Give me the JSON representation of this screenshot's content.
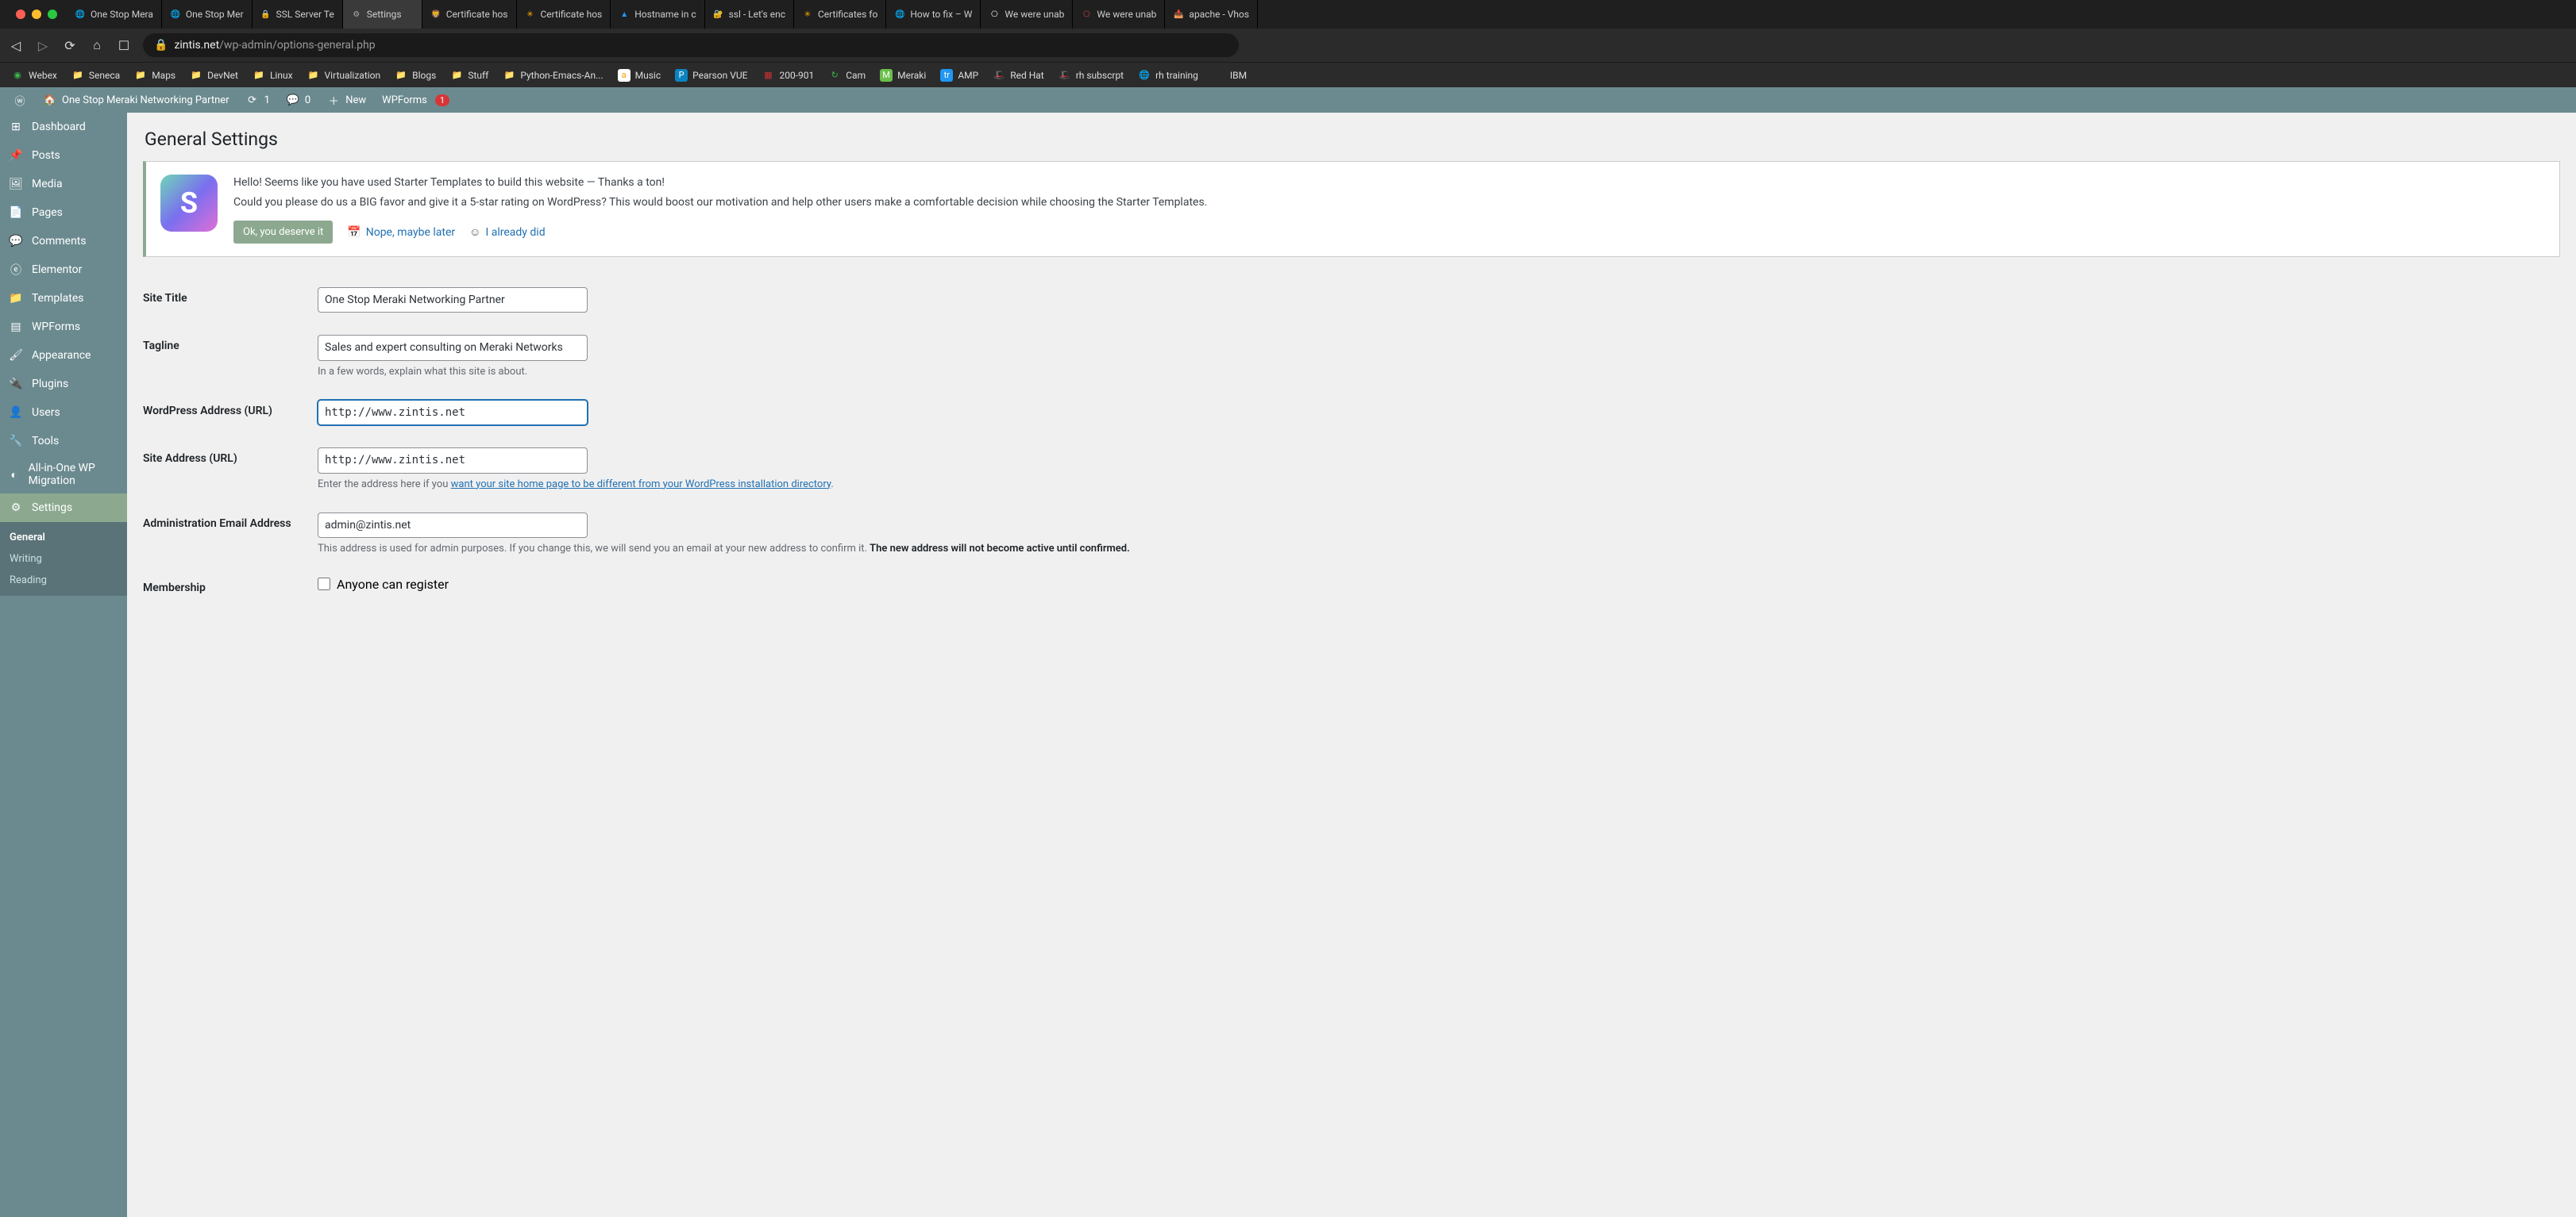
{
  "browser": {
    "tabs": [
      {
        "icon": "🌐",
        "label": "One Stop Mera",
        "color": "#1e8cbe"
      },
      {
        "icon": "🌐",
        "label": "One Stop Mer",
        "color": "#1e8cbe"
      },
      {
        "icon": "🔒",
        "label": "SSL Server Te",
        "color": "#2a7ab0"
      },
      {
        "icon": "⚙",
        "label": "Settings",
        "color": "#aaa",
        "active": true
      },
      {
        "icon": "🦁",
        "label": "Certificate hos",
        "color": "#f60"
      },
      {
        "icon": "✳",
        "label": "Certificate hos",
        "color": "#fa0"
      },
      {
        "icon": "▲",
        "label": "Hostname in c",
        "color": "#29f"
      },
      {
        "icon": "🔐",
        "label": "ssl - Let's enc",
        "color": "#2a7ab0"
      },
      {
        "icon": "✳",
        "label": "Certificates fo",
        "color": "#fa0"
      },
      {
        "icon": "🌐",
        "label": "How to fix – W",
        "color": "#888"
      },
      {
        "icon": "⎔",
        "label": "We were unab",
        "color": "#fff"
      },
      {
        "icon": "⎔",
        "label": "We were unab",
        "color": "#d44"
      },
      {
        "icon": "📥",
        "label": "apache - Vhos",
        "color": "#f80"
      }
    ],
    "url": {
      "host": "zintis.net",
      "path": "/wp-admin/options-general.php"
    },
    "bookmarks": [
      {
        "icon": "◉",
        "label": "Webex",
        "color": "#3cb44b"
      },
      {
        "icon": "📁",
        "label": "Seneca"
      },
      {
        "icon": "📁",
        "label": "Maps"
      },
      {
        "icon": "📁",
        "label": "DevNet"
      },
      {
        "icon": "📁",
        "label": "Linux"
      },
      {
        "icon": "📁",
        "label": "Virtualization"
      },
      {
        "icon": "📁",
        "label": "Blogs"
      },
      {
        "icon": "📁",
        "label": "Stuff"
      },
      {
        "icon": "📁",
        "label": "Python-Emacs-An..."
      },
      {
        "icon": "a",
        "label": "Music",
        "color": "#f90",
        "bg": "#fff"
      },
      {
        "icon": "P",
        "label": "Pearson VUE",
        "color": "#fff",
        "bg": "#0a84c1"
      },
      {
        "icon": "▦",
        "label": "200-901",
        "color": "#c33"
      },
      {
        "icon": "↻",
        "label": "Cam",
        "color": "#3cb44b"
      },
      {
        "icon": "M",
        "label": "Meraki",
        "color": "#fff",
        "bg": "#6bbf4b"
      },
      {
        "icon": "tr",
        "label": "AMP",
        "color": "#fff",
        "bg": "#2196f3"
      },
      {
        "icon": "🎩",
        "label": "Red Hat",
        "color": "#e00"
      },
      {
        "icon": "🎩",
        "label": "rh subscrpt",
        "color": "#e00"
      },
      {
        "icon": "🌐",
        "label": "rh training",
        "color": "#aaa"
      },
      {
        "icon": "",
        "label": "IBM"
      }
    ]
  },
  "adminbar": {
    "site_name": "One Stop Meraki Networking Partner",
    "updates_count": "1",
    "comments_count": "0",
    "new_label": "New",
    "wpforms_label": "WPForms",
    "wpforms_badge": "1"
  },
  "sidebar": {
    "items": [
      {
        "icon": "dashboard",
        "label": "Dashboard"
      },
      {
        "icon": "pin",
        "label": "Posts"
      },
      {
        "icon": "media",
        "label": "Media"
      },
      {
        "icon": "page",
        "label": "Pages"
      },
      {
        "icon": "comment",
        "label": "Comments"
      },
      {
        "icon": "elementor",
        "label": "Elementor"
      },
      {
        "icon": "templates",
        "label": "Templates"
      },
      {
        "icon": "wpforms",
        "label": "WPForms"
      },
      {
        "icon": "brush",
        "label": "Appearance"
      },
      {
        "icon": "plug",
        "label": "Plugins"
      },
      {
        "icon": "user",
        "label": "Users"
      },
      {
        "icon": "wrench",
        "label": "Tools"
      },
      {
        "icon": "migrate",
        "label": "All-in-One WP Migration"
      },
      {
        "icon": "sliders",
        "label": "Settings"
      }
    ],
    "submenu": [
      {
        "label": "General",
        "current": true
      },
      {
        "label": "Writing"
      },
      {
        "label": "Reading"
      }
    ]
  },
  "page": {
    "title": "General Settings",
    "notice": {
      "line1": "Hello! Seems like you have used Starter Templates to build this website — Thanks a ton!",
      "line2": "Could you please do us a BIG favor and give it a 5-star rating on WordPress? This would boost our motivation and help other users make a comfortable decision while choosing the Starter Templates.",
      "btn_ok": "Ok, you deserve it",
      "link_later": "Nope, maybe later",
      "link_done": "I already did"
    },
    "form": {
      "site_title_label": "Site Title",
      "site_title_value": "One Stop Meraki Networking Partner",
      "tagline_label": "Tagline",
      "tagline_value": "Sales and expert consulting on Meraki Networks",
      "tagline_desc": "In a few words, explain what this site is about.",
      "wpurl_label": "WordPress Address (URL)",
      "wpurl_value": "http://www.zintis.net",
      "siteurl_label": "Site Address (URL)",
      "siteurl_value": "http://www.zintis.net",
      "siteurl_desc_pre": "Enter the address here if you ",
      "siteurl_desc_link": "want your site home page to be different from your WordPress installation directory",
      "siteurl_desc_post": ".",
      "admin_email_label": "Administration Email Address",
      "admin_email_value": "admin@zintis.net",
      "admin_email_desc_pre": "This address is used for admin purposes. If you change this, we will send you an email at your new address to confirm it. ",
      "admin_email_desc_strong": "The new address will not become active until confirmed.",
      "membership_label": "Membership",
      "membership_checkbox": "Anyone can register"
    }
  }
}
